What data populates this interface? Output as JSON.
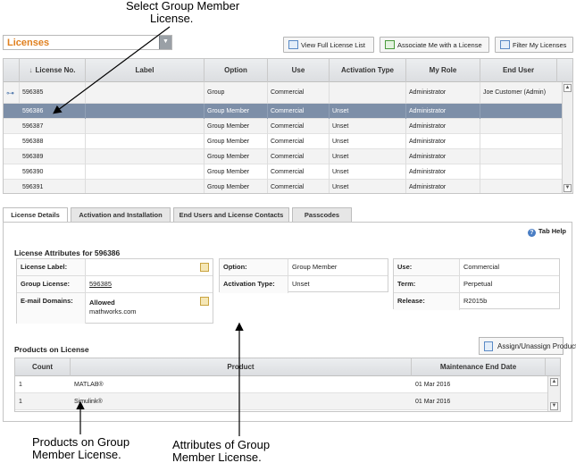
{
  "callouts": {
    "top_line1": "Select Group Member",
    "top_line2": "License.",
    "bottom_left_line1": "Products on Group",
    "bottom_left_line2": "Member License.",
    "bottom_mid_line1": "Attributes of Group",
    "bottom_mid_line2": "Member License."
  },
  "toolbar": {
    "license_selector": "Licenses",
    "view_full_list": "View Full License List",
    "associate_me": "Associate Me with a License",
    "filter_licenses": "Filter My Licenses"
  },
  "license_grid": {
    "columns": [
      "License No.",
      "Label",
      "Option",
      "Use",
      "Activation Type",
      "My Role",
      "End User"
    ],
    "sort_indicator": "↓",
    "rows": [
      {
        "license": "596385",
        "label": "",
        "option": "Group",
        "use": "Commercial",
        "activation": "",
        "role": "Administrator",
        "end_user": "Joe Customer (Admin)"
      },
      {
        "license": "596386",
        "label": "",
        "option": "Group Member",
        "use": "Commercial",
        "activation": "Unset",
        "role": "Administrator",
        "end_user": ""
      },
      {
        "license": "596387",
        "label": "",
        "option": "Group Member",
        "use": "Commercial",
        "activation": "Unset",
        "role": "Administrator",
        "end_user": ""
      },
      {
        "license": "596388",
        "label": "",
        "option": "Group Member",
        "use": "Commercial",
        "activation": "Unset",
        "role": "Administrator",
        "end_user": ""
      },
      {
        "license": "596389",
        "label": "",
        "option": "Group Member",
        "use": "Commercial",
        "activation": "Unset",
        "role": "Administrator",
        "end_user": ""
      },
      {
        "license": "596390",
        "label": "",
        "option": "Group Member",
        "use": "Commercial",
        "activation": "Unset",
        "role": "Administrator",
        "end_user": ""
      },
      {
        "license": "596391",
        "label": "",
        "option": "Group Member",
        "use": "Commercial",
        "activation": "Unset",
        "role": "Administrator",
        "end_user": ""
      }
    ],
    "selected_index": 1
  },
  "tabs": [
    "License Details",
    "Activation and Installation",
    "End Users and License Contacts",
    "Passcodes"
  ],
  "active_tab": 0,
  "tab_help": "Tab Help",
  "attributes": {
    "title": "License Attributes for 596386",
    "license_label_label": "License Label:",
    "license_label_value": "",
    "group_license_label": "Group License:",
    "group_license_value": "596385",
    "email_domains_label": "E-mail Domains:",
    "email_domains_status": "Allowed",
    "email_domains_value": "mathworks.com",
    "option_label": "Option:",
    "option_value": "Group Member",
    "activation_type_label": "Activation Type:",
    "activation_type_value": "Unset",
    "use_label": "Use:",
    "use_value": "Commercial",
    "term_label": "Term:",
    "term_value": "Perpetual",
    "release_label": "Release:",
    "release_value": "R2015b"
  },
  "products": {
    "title": "Products on License",
    "assign_button": "Assign/Unassign Products",
    "columns": [
      "Count",
      "Product",
      "Maintenance End Date"
    ],
    "rows": [
      {
        "count": "1",
        "product": "MATLAB®",
        "end_date": "01 Mar 2016"
      },
      {
        "count": "1",
        "product": "Simulink®",
        "end_date": "01 Mar 2016"
      }
    ]
  },
  "colors": {
    "accent_orange": "#e0801f",
    "selected_row": "#7d8fa8"
  }
}
